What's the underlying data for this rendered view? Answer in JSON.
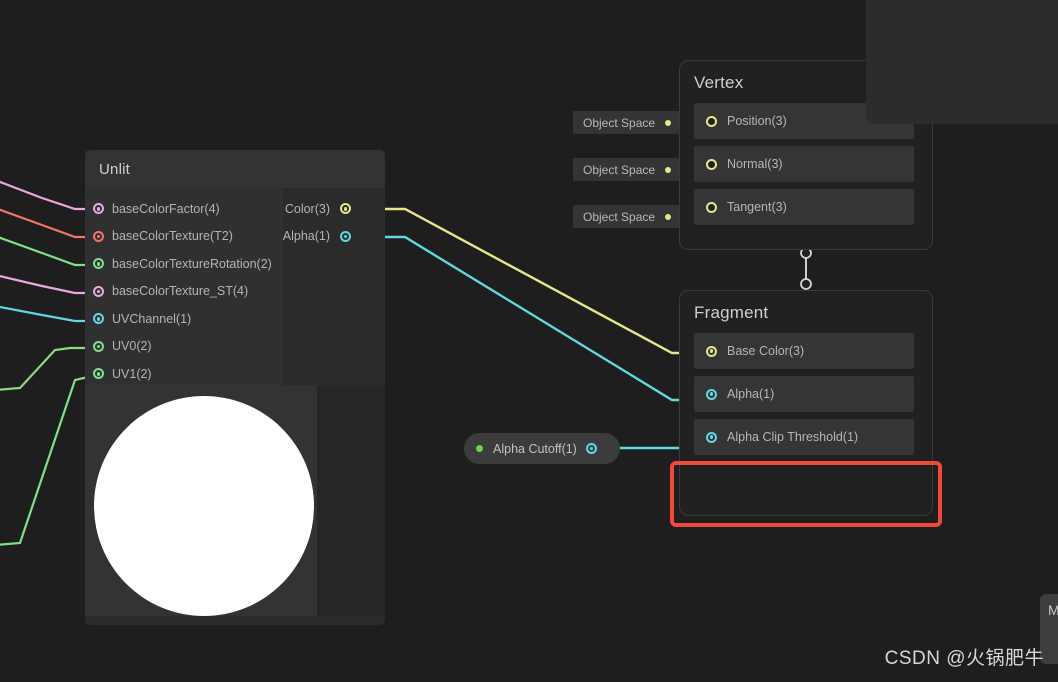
{
  "canvas": {
    "background": "#1e1e1e",
    "watermark": "CSDN @火锅肥牛"
  },
  "colors": {
    "wire_color_yellow": "#e6e68a",
    "wire_alpha_cyan": "#63d7e0",
    "wire_pink": "#e9a8e0",
    "wire_red": "#f4746c",
    "wire_green": "#7fe08a",
    "wire_lightgreen": "#8ed87f",
    "highlight_red": "#f0493c",
    "property_green": "#6fd14c",
    "node_body": "#2b2b2b",
    "node_header": "#333333",
    "master_body": "#212121",
    "slot_bg": "#353535",
    "text_primary": "#d0d0d0",
    "text_secondary": "#b4b4b4"
  },
  "unlit_node": {
    "title": "Unlit",
    "inputs": [
      {
        "label": "baseColorFactor(4)",
        "color": "#e9a8e0"
      },
      {
        "label": "baseColorTexture(T2)",
        "color": "#f4746c"
      },
      {
        "label": "baseColorTextureRotation(2)",
        "color": "#7fe08a"
      },
      {
        "label": "baseColorTexture_ST(4)",
        "color": "#e9a8e0"
      },
      {
        "label": "UVChannel(1)",
        "color": "#63d7e0"
      },
      {
        "label": "UV0(2)",
        "color": "#7fe08a"
      },
      {
        "label": "UV1(2)",
        "color": "#7fe08a"
      }
    ],
    "outputs": [
      {
        "label": "Color(3)",
        "color": "#e6e68a"
      },
      {
        "label": "Alpha(1)",
        "color": "#63d7e0"
      }
    ],
    "preview": {
      "shape": "sphere",
      "color": "#ffffff"
    }
  },
  "vertex_node": {
    "title": "Vertex",
    "slots": [
      {
        "label": "Position(3)",
        "space": "Object Space",
        "color": "#e6e68a"
      },
      {
        "label": "Normal(3)",
        "space": "Object Space",
        "color": "#e6e68a"
      },
      {
        "label": "Tangent(3)",
        "space": "Object Space",
        "color": "#e6e68a"
      }
    ]
  },
  "fragment_node": {
    "title": "Fragment",
    "slots": [
      {
        "label": "Base Color(3)",
        "color": "#e6e68a"
      },
      {
        "label": "Alpha(1)",
        "color": "#63d7e0"
      },
      {
        "label": "Alpha Clip Threshold(1)",
        "color": "#63d7e0"
      }
    ]
  },
  "alpha_cutoff_node": {
    "label": "Alpha Cutoff(1)",
    "property_dot_color": "#6fd14c",
    "port_color": "#63d7e0"
  },
  "right_panel": {
    "label": "M"
  },
  "annotation": {
    "shape": "rectangle",
    "color": "#f0493c",
    "target": "fragment-node-bottom"
  }
}
